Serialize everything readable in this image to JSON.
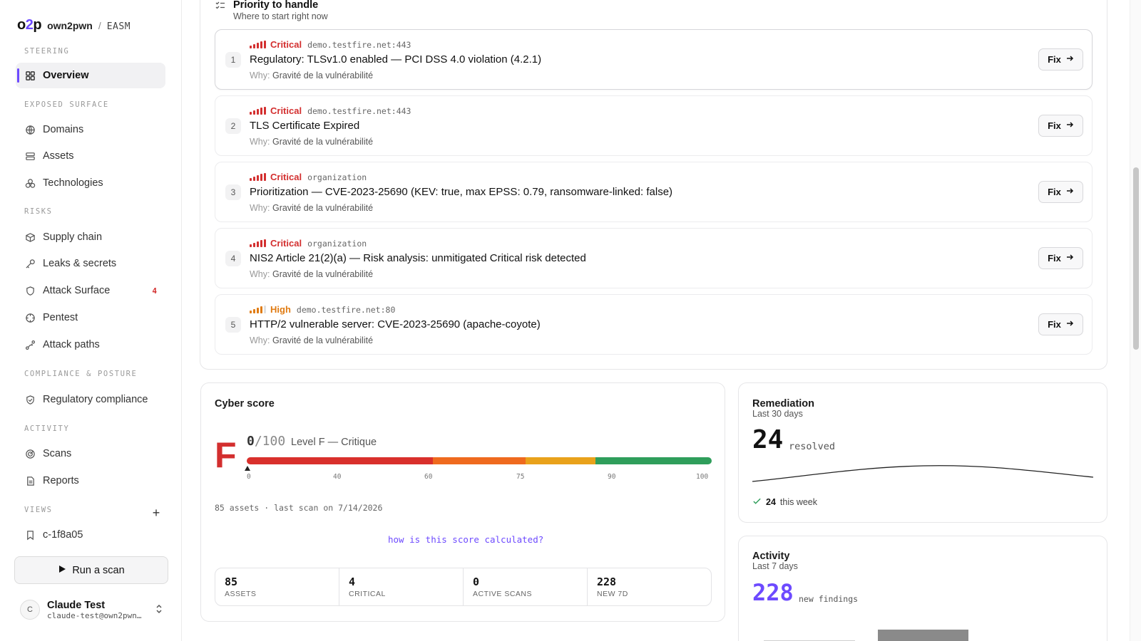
{
  "brand": {
    "logo": "o2p",
    "logo_left": "o",
    "logo_mid": "2",
    "logo_right": "p",
    "org": "own2pwn",
    "sep": "/",
    "app": "EASM"
  },
  "sidebar": {
    "sections": {
      "steering": "STEERING",
      "exposed": "EXPOSED SURFACE",
      "risks": "RISKS",
      "compliance": "COMPLIANCE & POSTURE",
      "activity": "ACTIVITY",
      "views": "VIEWS"
    },
    "items": {
      "overview": "Overview",
      "domains": "Domains",
      "assets": "Assets",
      "technologies": "Technologies",
      "supply_chain": "Supply chain",
      "leaks": "Leaks & secrets",
      "attack_surface": "Attack Surface",
      "attack_surface_badge": "4",
      "pentest": "Pentest",
      "attack_paths": "Attack paths",
      "regulatory": "Regulatory compliance",
      "scans": "Scans",
      "reports": "Reports",
      "view_1": "c-1f8a05"
    },
    "views_add": "+",
    "run_scan": "Run a scan",
    "user": {
      "initial": "C",
      "name": "Claude Test",
      "email": "claude-test@own2pwn…"
    }
  },
  "priority": {
    "title": "Priority to handle",
    "subtitle": "Where to start right now",
    "why_label": "Why:",
    "fix_label": "Fix",
    "items": [
      {
        "rank": "1",
        "severity": "Critical",
        "target": "demo.testfire.net:443",
        "title": "Regulatory: TLSv1.0 enabled — PCI DSS 4.0 violation (4.2.1)",
        "why": "Gravité de la vulnérabilité"
      },
      {
        "rank": "2",
        "severity": "Critical",
        "target": "demo.testfire.net:443",
        "title": "TLS Certificate Expired",
        "why": "Gravité de la vulnérabilité"
      },
      {
        "rank": "3",
        "severity": "Critical",
        "target": "organization",
        "title": "Prioritization — CVE-2023-25690 (KEV: true, max EPSS: 0.79, ransomware-linked: false)",
        "why": "Gravité de la vulnérabilité"
      },
      {
        "rank": "4",
        "severity": "Critical",
        "target": "organization",
        "title": "NIS2 Article 21(2)(a) — Risk analysis: unmitigated Critical risk detected",
        "why": "Gravité de la vulnérabilité"
      },
      {
        "rank": "5",
        "severity": "High",
        "target": "demo.testfire.net:80",
        "title": "HTTP/2 vulnerable server: CVE-2023-25690 (apache-coyote)",
        "why": "Gravité de la vulnérabilité"
      }
    ]
  },
  "cyber_score": {
    "title": "Cyber score",
    "grade": "F",
    "value": "0",
    "denominator": "/100",
    "level": "Level F — Critique",
    "score_fraction": 0,
    "ticks": [
      "0",
      "40",
      "60",
      "75",
      "90",
      "100"
    ],
    "meta": "85 assets · last scan on 7/14/2026",
    "link": "how is this score calculated?",
    "stats": [
      {
        "value": "85",
        "label": "ASSETS"
      },
      {
        "value": "4",
        "label": "CRITICAL"
      },
      {
        "value": "0",
        "label": "ACTIVE SCANS"
      },
      {
        "value": "228",
        "label": "NEW 7D"
      }
    ],
    "colors": {
      "red": "#d9302c",
      "orange": "#ef6a1e",
      "amber": "#e9a21b",
      "green": "#2f9e5b"
    }
  },
  "remediation": {
    "title": "Remediation",
    "subtitle": "Last 30 days",
    "value": "24",
    "unit": "resolved",
    "week_value": "24",
    "week_label": "this week"
  },
  "activity": {
    "title": "Activity",
    "subtitle": "Last 7 days",
    "value": "228",
    "unit": "new findings"
  },
  "colors": {
    "accent": "#6d4aff",
    "critical": "#d32f2f",
    "high": "#e07b12"
  }
}
